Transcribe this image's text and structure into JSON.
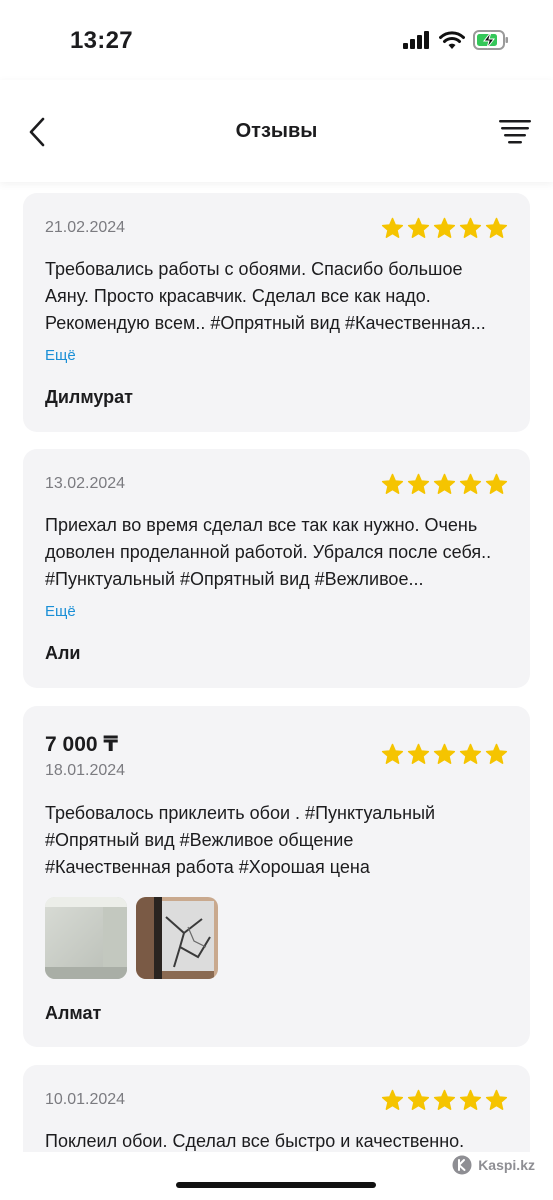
{
  "status_bar": {
    "time": "13:27"
  },
  "nav": {
    "title": "Отзывы"
  },
  "reviews": [
    {
      "date": "21.02.2024",
      "rating": 5,
      "text_lines": [
        "Требовались работы с обоями. Спасибо большое",
        "Аяну. Просто красавчик. Сделал все как надо.",
        "Рекомендую всем.. #Опрятный вид #Качественная..."
      ],
      "more": "Ещё",
      "author": "Дилмурат"
    },
    {
      "date": "13.02.2024",
      "rating": 5,
      "text_lines": [
        "Приехал во время сделал все так как нужно. Очень",
        "доволен проделанной работой. Убрался после себя..",
        "#Пунктуальный #Опрятный вид #Вежливое..."
      ],
      "more": "Ещё",
      "author": "Али"
    },
    {
      "price": "7 000 ₸",
      "date": "18.01.2024",
      "rating": 5,
      "text_lines": [
        "Требовалось приклеить обои . #Пунктуальный",
        "#Опрятный вид #Вежливое общение",
        "#Качественная работа #Хорошая цена"
      ],
      "photos": 2,
      "author": "Алмат"
    },
    {
      "date": "10.01.2024",
      "rating": 5,
      "text_lines": [
        "Поклеил обои. Сделал все быстро и качественно."
      ]
    }
  ],
  "watermark": "Kaspi.kz",
  "colors": {
    "star": "#f5c400",
    "link": "#1a8fd6",
    "card_bg": "#f4f4f6",
    "date": "#7b7b80"
  },
  "icons": [
    "back-chevron-icon",
    "filter-icon",
    "signal-icon",
    "wifi-icon",
    "battery-charging-icon",
    "star-icon",
    "kaspi-logo-icon"
  ]
}
